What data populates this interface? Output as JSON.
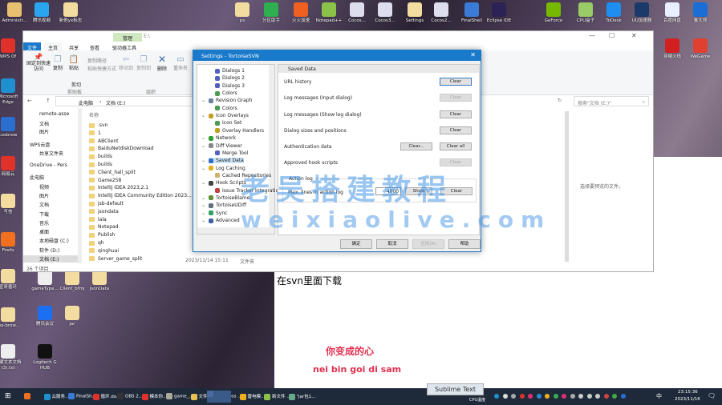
{
  "desktop": {
    "top_icons": [
      {
        "label": "Administr...",
        "color": "#e8c070"
      },
      {
        "label": "腾讯视频",
        "color": "#2aa6f0"
      },
      {
        "label": "新他yx标志",
        "color": "#f3dca0"
      },
      {
        "label": "ps",
        "color": "#f3dca0"
      },
      {
        "label": "分区助手",
        "color": "#2fb050"
      },
      {
        "label": "火火加速",
        "color": "#f06020"
      },
      {
        "label": "Notepad++",
        "color": "#8bc34a"
      },
      {
        "label": "Cocos...",
        "color": "#dde"
      },
      {
        "label": "Cocos3...",
        "color": "#dde"
      },
      {
        "label": "Settings",
        "color": "#f3dca0"
      },
      {
        "label": "Cocos2...",
        "color": "#dde"
      },
      {
        "label": "FinalShell",
        "color": "#3a7bd5"
      },
      {
        "label": "Eclipse IDE",
        "color": "#2c2255"
      },
      {
        "label": "GeForce",
        "color": "#76b900"
      },
      {
        "label": "CPU盒子",
        "color": "#9c6"
      },
      {
        "label": "ToDesk",
        "color": "#1e8ef0"
      },
      {
        "label": "UU加速器",
        "color": "#1a3a6a"
      },
      {
        "label": "百度网盘",
        "color": "#e8f0ff"
      },
      {
        "label": "鲁大师",
        "color": "#1b6ed6"
      }
    ],
    "right_icons": [
      {
        "label": "穿越火线",
        "color": "#d02020"
      },
      {
        "label": "WeGame",
        "color": "#e04030"
      }
    ],
    "left_icons": [
      {
        "label": "WPS Of",
        "color": "#e0312b"
      },
      {
        "label": "Microsoft Edge",
        "color": "#1e90d0"
      },
      {
        "label": "cosbrow",
        "color": "#2a6fd0"
      },
      {
        "label": "网易云",
        "color": "#e0312b"
      },
      {
        "label": "写信",
        "color": "#f3dca0"
      },
      {
        "label": "Firefo",
        "color": "#f07020"
      },
      {
        "label": "宣哥循环",
        "color": "#f3dca0"
      },
      {
        "label": "oss-brow...",
        "color": "#f3dca0"
      },
      {
        "label": "新建文本文档(3).txt",
        "color": "#eee"
      }
    ],
    "mid_icons": [
      {
        "label": "gameType...",
        "color": "#eee"
      },
      {
        "label": "Client_bfmj",
        "color": "#f3dca0"
      },
      {
        "label": "jsonData",
        "color": "#f3dca0"
      },
      {
        "label": "腾讯会议",
        "color": "#1d6ff2"
      },
      {
        "label": "jar",
        "color": "#f3dca0"
      },
      {
        "label": "Logitech G HUB",
        "color": "#111"
      }
    ]
  },
  "document": {
    "heading": "在svn里面下载",
    "lyric_cn": "你变成的心",
    "lyric_pinyin": "nei bin goi di sam",
    "lyric_color": "#e03050"
  },
  "explorer": {
    "title": "E:\\",
    "manage_tab": "管理",
    "tabs": [
      "文件",
      "主页",
      "共享",
      "查看",
      "驱动器工具"
    ],
    "ribbon": {
      "pin": "固定到快速访问",
      "copy": "复制",
      "paste": "粘贴",
      "copy_path": "复制路径",
      "paste_shortcut": "粘贴快捷方式",
      "cut": "剪切",
      "clipboard_group": "剪贴板",
      "move_to": "移动到",
      "copy_to": "复制到",
      "delete": "删除",
      "rename": "重命名",
      "organize_group": "组织"
    },
    "breadcrumb": [
      "此电脑",
      "文档 (E:)"
    ],
    "search_placeholder": "搜索\"文档 (E:)\"",
    "nav": [
      "remote-asse",
      "文档",
      "图片",
      "WPS云盘",
      "共享文件夹",
      "OneDrive - Pers",
      "此电脑",
      "视频",
      "图片",
      "文档",
      "下载",
      "音乐",
      "桌面",
      "本地磁盘 (C:)",
      "软件 (D:)",
      "文档 (E:)"
    ],
    "column_name": "名称",
    "files": [
      ".svn",
      "1",
      "ABClient",
      "BaiduNetdiskDownload",
      "builds",
      "builds",
      "Client_hall_split",
      "Game258",
      "IntelliJ IDEA 2023.2.1",
      "IntelliJ IDEA Community Edition 2023...",
      "jsb-default",
      "jsondata",
      "lala",
      "Notepad",
      "Publish",
      "qh",
      "qinghuai",
      "Server_game_split"
    ],
    "last_date": "2023/11/14 15:11",
    "last_type": "文件夹",
    "preview_text": "选择要预览的文件。",
    "status": "26 个项目"
  },
  "settings": {
    "title": "Settings - TortoiseSVN",
    "tree": [
      {
        "label": "Dialogs 1",
        "lvl": 2,
        "c": "#5060c0"
      },
      {
        "label": "Dialogs 2",
        "lvl": 2,
        "c": "#5060c0"
      },
      {
        "label": "Dialogs 3",
        "lvl": 2,
        "c": "#5060c0"
      },
      {
        "label": "Colors",
        "lvl": 2,
        "c": "#4a9a50"
      },
      {
        "label": "Revision Graph",
        "lvl": 1,
        "c": "#7080a0"
      },
      {
        "label": "Colors",
        "lvl": 2,
        "c": "#4a9a50"
      },
      {
        "label": "Icon Overlays",
        "lvl": 1,
        "c": "#c0a020"
      },
      {
        "label": "Icon Set",
        "lvl": 2,
        "c": "#4a9a50"
      },
      {
        "label": "Overlay Handlers",
        "lvl": 2,
        "c": "#c0a020"
      },
      {
        "label": "Network",
        "lvl": 1,
        "c": "#30a030"
      },
      {
        "label": "Diff Viewer",
        "lvl": 1,
        "c": "#888"
      },
      {
        "label": "Merge Tool",
        "lvl": 2,
        "c": "#5060c0"
      },
      {
        "label": "Saved Data",
        "lvl": 1,
        "c": "#3070c0"
      },
      {
        "label": "Log Caching",
        "lvl": 1,
        "c": "#e0b020"
      },
      {
        "label": "Cached Repositories",
        "lvl": 2,
        "c": "#d0b070"
      },
      {
        "label": "Hook Scripts",
        "lvl": 1,
        "c": "#444"
      },
      {
        "label": "Issue Tracker Integration",
        "lvl": 2,
        "c": "#c04040"
      },
      {
        "label": "TortoiseBlame",
        "lvl": 1,
        "c": "#609030"
      },
      {
        "label": "TortoiseUDiff",
        "lvl": 1,
        "c": "#607080"
      },
      {
        "label": "Sync",
        "lvl": 1,
        "c": "#30a060"
      },
      {
        "label": "Advanced",
        "lvl": 1,
        "c": "#4060a0"
      }
    ],
    "selected": "Saved Data",
    "panel_title": "Saved Data",
    "rows": [
      {
        "label": "URL history",
        "btn": "Clear",
        "enabled": true
      },
      {
        "label": "Log messages (Input dialog)",
        "btn": "Clear",
        "enabled": false
      },
      {
        "label": "Log messages (Show log dialog)",
        "btn": "Clear",
        "enabled": true
      },
      {
        "label": "Dialog sizes and positions",
        "btn": "Clear",
        "enabled": true
      },
      {
        "label": "Authentication data",
        "btn": "Clear all",
        "btn2": "Clear...",
        "enabled": true
      },
      {
        "label": "Approved hook scripts",
        "btn": "Clear",
        "enabled": false
      }
    ],
    "action_log": {
      "group": "Action log",
      "label": "Max. lines in action log",
      "value": "4000",
      "show": "Show",
      "clear": "Clear"
    },
    "footer": {
      "ok": "确定",
      "cancel": "取消",
      "apply": "应用(A)",
      "help": "帮助"
    }
  },
  "watermark": {
    "cn": "老吴搭建教程",
    "url": "weixiaolive.com"
  },
  "taskbar": {
    "items": [
      {
        "label": "",
        "c": "#f07020"
      },
      {
        "label": "云服务...",
        "c": "#1e90d0"
      },
      {
        "label": "FinalSh...",
        "c": "#3a7bd5"
      },
      {
        "label": "循环.do...",
        "c": "#e0312b"
      },
      {
        "label": "OBS 2...",
        "c": "#333"
      },
      {
        "label": "模本你...",
        "c": "#e0312b"
      },
      {
        "label": "game_...",
        "c": "#aa9"
      },
      {
        "label": "文件资...",
        "c": "#e8c050"
      },
      {
        "label": "Cocos ...",
        "c": "#ccc"
      },
      {
        "label": "雷电模...",
        "c": "#f0b020"
      },
      {
        "label": "新文件 ...",
        "c": "#8bc34a"
      },
      {
        "label": "\"jar包1...",
        "c": "#6a8"
      },
      {
        "label": "",
        "c": "#4a6aa0"
      }
    ],
    "tooltip": "Sublime Text",
    "cpu": "CPU温度",
    "ime": "中",
    "time": "23:15:36",
    "date": "2023/11/16"
  }
}
